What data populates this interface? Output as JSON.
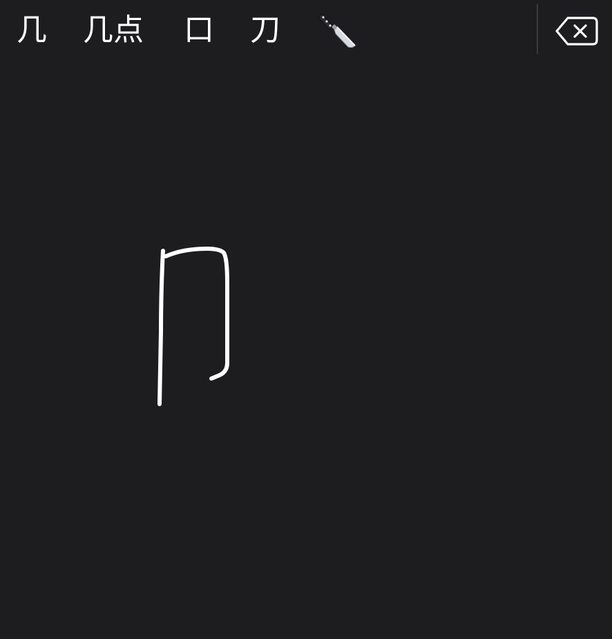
{
  "candidates": [
    {
      "label": "几"
    },
    {
      "label": "几点"
    },
    {
      "label": "口"
    },
    {
      "label": "刀"
    },
    {
      "label": "",
      "icon": "kitchen-knife-emoji"
    }
  ],
  "delete_key": {
    "icon": "backspace-icon"
  },
  "handwriting": {
    "strokes": 2
  },
  "colors": {
    "background": "#1d1c1f",
    "text": "#ffffff",
    "divider": "#3a393c",
    "ink": "#ffffff"
  }
}
